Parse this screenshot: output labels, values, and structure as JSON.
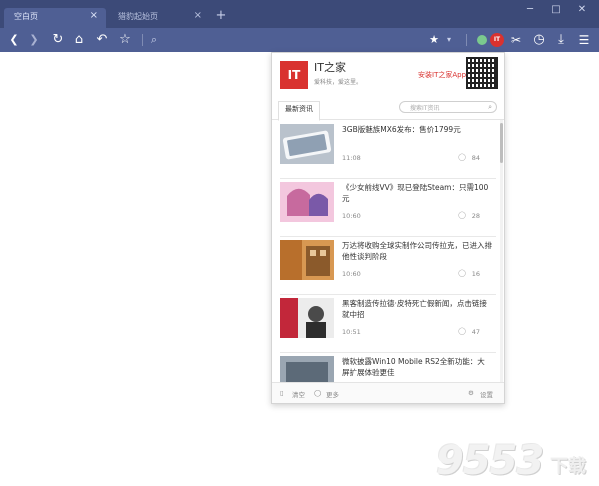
{
  "tabs": [
    {
      "label": "空白页"
    },
    {
      "label": "猎豹起始页"
    }
  ],
  "new_tab_symbol": "+",
  "tab_close_symbol": "×",
  "window_controls": {
    "minimize": "─",
    "maximize": "□",
    "close": "✕"
  },
  "toolbar_icons": {
    "back": "❮",
    "forward": "❯",
    "refresh": "↻",
    "home": "⌂",
    "undo": "↶",
    "favorite": "☆",
    "search": "⌕",
    "star": "★",
    "caret": "▾",
    "scissors": "✂",
    "clock": "◷",
    "download": "⤓",
    "menu": "☰"
  },
  "it_button_label": "IT",
  "panel": {
    "logo_text": "IT",
    "brand": "IT之家",
    "tagline": "爱科技，爱这里。",
    "install_label": "安装IT之家App",
    "tab_label": "最新资讯",
    "search_placeholder": "搜索IT资讯",
    "search_icon": "⌕",
    "comment_icon": "◯",
    "items": [
      {
        "title": "3GB版魅族MX6发布：售价1799元",
        "time": "11:08",
        "comments": "84"
      },
      {
        "title": "《少女前线VV》现已登陆Steam：只需100元",
        "time": "10:60",
        "comments": "28"
      },
      {
        "title": "万达将收购全球实制作公司传拉克，已进入排他性谈判阶段",
        "time": "10:60",
        "comments": "16"
      },
      {
        "title": "黑客制造传拉德·皮特死亡假新闻，点击链接就中招",
        "time": "10:51",
        "comments": "47"
      },
      {
        "title": "微软披露Win10 Mobile RS2全新功能：大屏扩展体验更佳",
        "time": "",
        "comments": ""
      }
    ],
    "footer": {
      "clear_icon": "▯",
      "clear": "清空",
      "more_icon": "◯",
      "more": "更多",
      "settings_icon": "⚙",
      "settings": "设置"
    }
  },
  "watermark": {
    "number": "9553",
    "text": "下载"
  }
}
